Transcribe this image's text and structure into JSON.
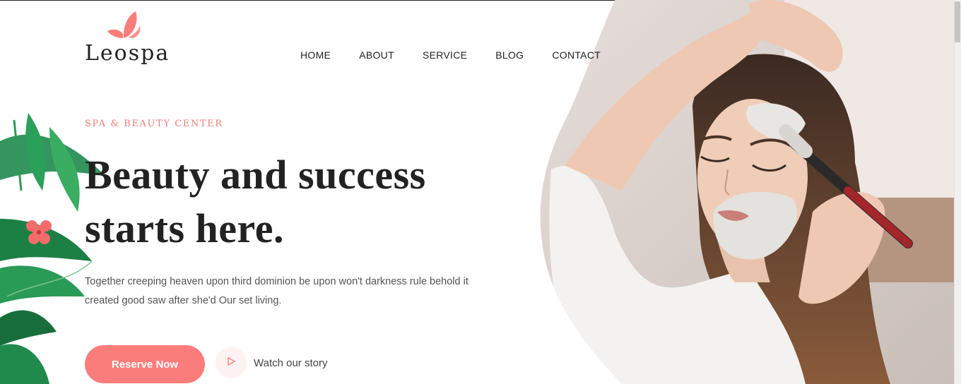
{
  "brand": {
    "name": "Leospa",
    "logo_icon": "butterfly-icon",
    "accent_color": "#fb7d7b"
  },
  "nav": {
    "items": [
      {
        "label": "HOME"
      },
      {
        "label": "ABOUT"
      },
      {
        "label": "SERVICE"
      },
      {
        "label": "BLOG"
      },
      {
        "label": "CONTACT"
      }
    ]
  },
  "hero": {
    "eyebrow": "SPA & BEAUTY CENTER",
    "headline_line1": "Beauty and success",
    "headline_line2": "starts here.",
    "description": "Together creeping heaven upon third dominion be upon won't darkness rule behold it created good saw after she'd Our set living.",
    "reserve_label": "Reserve Now",
    "play_icon": "play-icon",
    "watch_label": "Watch our story",
    "image": "woman-face-mask-photo"
  }
}
